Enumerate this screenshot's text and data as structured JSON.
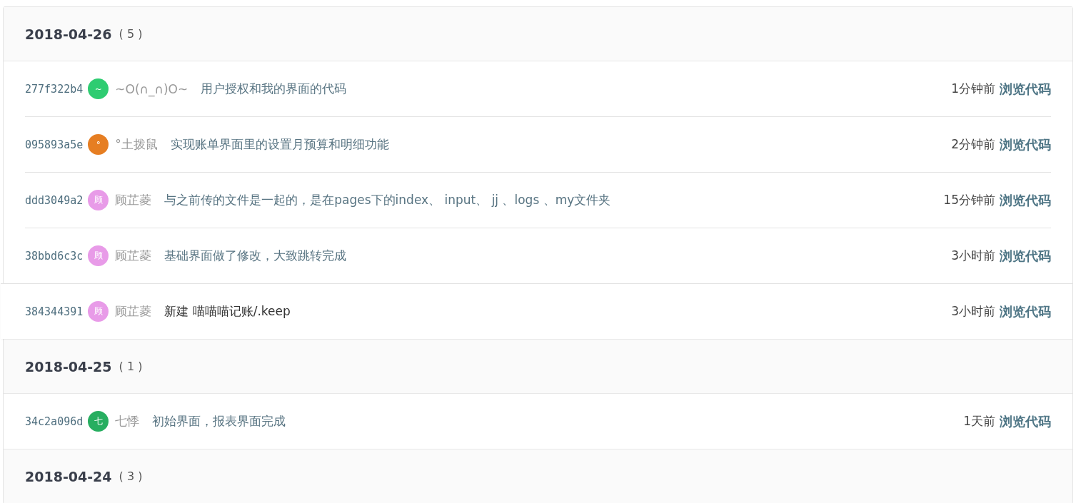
{
  "groups": [
    {
      "date": "2018-04-26",
      "count": "( 5 )",
      "commits": [
        {
          "hash": "277f322b4",
          "avatar": "~",
          "color": "#2ecc71",
          "author": "~O(∩_∩)O~",
          "message": "用户授权和我的界面的代码",
          "time": "1分钟前",
          "link": "浏览代码",
          "hovered": false
        },
        {
          "hash": "095893a5e",
          "avatar": "°",
          "color": "#e67e22",
          "author": "°土拨鼠",
          "message": "实现账单界面里的设置月预算和明细功能",
          "time": "2分钟前",
          "link": "浏览代码",
          "hovered": false
        },
        {
          "hash": "ddd3049a2",
          "avatar": "顾",
          "color": "#e89be8",
          "author": "顾芷菱",
          "message": "与之前传的文件是一起的，是在pages下的index、 input、 jj 、logs 、my文件夹",
          "time": "15分钟前",
          "link": "浏览代码",
          "hovered": false
        },
        {
          "hash": "38bbd6c3c",
          "avatar": "顾",
          "color": "#e89be8",
          "author": "顾芷菱",
          "message": "基础界面做了修改，大致跳转完成",
          "time": "3小时前",
          "link": "浏览代码",
          "hovered": false
        },
        {
          "hash": "384344391",
          "avatar": "顾",
          "color": "#e89be8",
          "author": "顾芷菱",
          "message": "新建 喵喵喵记账/.keep",
          "time": "3小时前",
          "link": "浏览代码",
          "hovered": true
        }
      ]
    },
    {
      "date": "2018-04-25",
      "count": "( 1 )",
      "commits": [
        {
          "hash": "34c2a096d",
          "avatar": "七",
          "color": "#27ae60",
          "author": "七悸",
          "message": "初始界面，报表界面完成",
          "time": "1天前",
          "link": "浏览代码",
          "hovered": false
        }
      ]
    },
    {
      "date": "2018-04-24",
      "count": "( 3 )"
    }
  ]
}
